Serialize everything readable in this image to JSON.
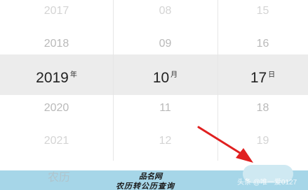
{
  "picker": {
    "year": {
      "items": [
        "2017",
        "2018",
        "2019",
        "2020",
        "2021"
      ],
      "unit": "年"
    },
    "month": {
      "items": [
        "08",
        "09",
        "10",
        "11",
        "12"
      ],
      "unit": "月"
    },
    "day": {
      "items": [
        "15",
        "16",
        "17",
        "18",
        "19"
      ],
      "unit": "日"
    }
  },
  "bottom": {
    "lunar_label": "农历",
    "watermark_title": "品名网",
    "watermark_subtitle": "农历转公历查询",
    "credit": "头条 @唯一爱0127"
  },
  "colors": {
    "highlight": "#ececec",
    "bar": "#a6d6e8",
    "arrow": "#e02020"
  },
  "icons": [
    "red-arrow-icon"
  ]
}
